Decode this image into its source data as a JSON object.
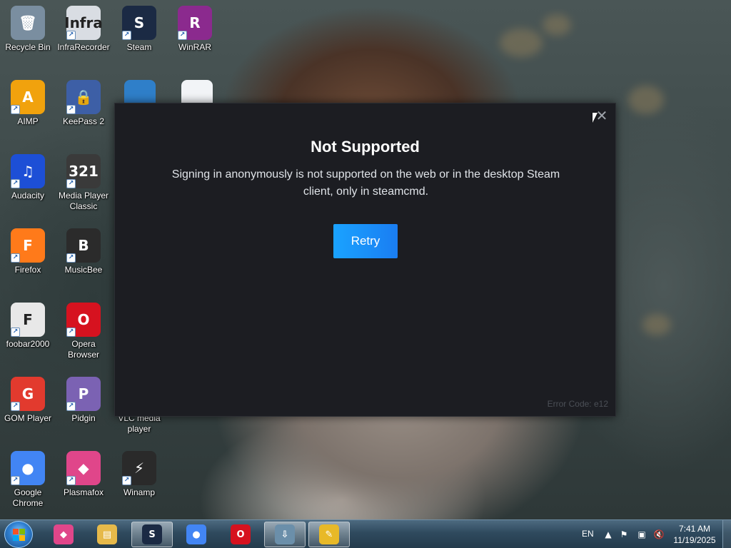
{
  "desktop": {
    "icons": [
      {
        "label": "Recycle Bin",
        "icon": "recycle-bin-icon",
        "glyph": "🗑",
        "color": "#7a8ea0"
      },
      {
        "label": "InfraRecorder",
        "icon": "infrarecorder-icon",
        "glyph": "Infra",
        "color": "#d9dde3"
      },
      {
        "label": "Steam",
        "icon": "steam-icon",
        "glyph": "S",
        "color": "#1b2a44"
      },
      {
        "label": "WinRAR",
        "icon": "winrar-icon",
        "glyph": "R",
        "color": "#8b2a8e"
      },
      {
        "label": "AIMP",
        "icon": "aimp-icon",
        "glyph": "A",
        "color": "#f1a20d"
      },
      {
        "label": "KeePass 2",
        "icon": "keepass-icon",
        "glyph": "🔒",
        "color": "#3d5fa6"
      },
      {
        "label": "Audacity",
        "icon": "audacity-icon",
        "glyph": "♫",
        "color": "#1d4fd6"
      },
      {
        "label": "Media Player Classic",
        "icon": "media-player-classic-icon",
        "glyph": "321",
        "color": "#3a3a3a"
      },
      {
        "label": "Firefox",
        "icon": "firefox-icon",
        "glyph": "F",
        "color": "#ff7a1a"
      },
      {
        "label": "MusicBee",
        "icon": "musicbee-icon",
        "glyph": "B",
        "color": "#2b2b2b"
      },
      {
        "label": "foobar2000",
        "icon": "foobar2000-icon",
        "glyph": "F",
        "color": "#e8e8e8"
      },
      {
        "label": "Opera Browser",
        "icon": "opera-icon",
        "glyph": "O",
        "color": "#d6121f"
      },
      {
        "label": "GOM Player",
        "icon": "gom-player-icon",
        "glyph": "G",
        "color": "#e23a2e"
      },
      {
        "label": "Pidgin",
        "icon": "pidgin-icon",
        "glyph": "P",
        "color": "#7b62b3"
      },
      {
        "label": "VLC media player",
        "icon": "vlc-icon",
        "glyph": "▲",
        "color": "#f08a00"
      },
      {
        "label": "Google Chrome",
        "icon": "chrome-icon",
        "glyph": "●",
        "color": "#4285f4"
      },
      {
        "label": "Plasmafox",
        "icon": "plasmafox-icon",
        "glyph": "◆",
        "color": "#e0468a"
      },
      {
        "label": "Winamp",
        "icon": "winamp-icon",
        "glyph": "⚡",
        "color": "#2a2a2a"
      }
    ],
    "partial_icons": [
      {
        "icon": "browser-icon",
        "color": "#2f7fc9"
      },
      {
        "icon": "document-icon",
        "color": "#f2f4f7"
      }
    ]
  },
  "dialog": {
    "title": "Not Supported",
    "message": "Signing in anonymously is not supported on the web or in the desktop Steam client, only in steamcmd.",
    "retry_label": "Retry",
    "error_code": "Error Code: e12",
    "close_glyph": "✕"
  },
  "taskbar": {
    "items": [
      {
        "icon": "plasmafox-icon",
        "glyph": "◆",
        "color": "#e0468a",
        "active": false
      },
      {
        "icon": "file-explorer-icon",
        "glyph": "▤",
        "color": "#e6b94a",
        "active": false
      },
      {
        "icon": "steam-icon",
        "glyph": "S",
        "color": "#1b2a44",
        "active": true
      },
      {
        "icon": "chrome-icon",
        "glyph": "●",
        "color": "#4285f4",
        "active": false
      },
      {
        "icon": "opera-icon",
        "glyph": "O",
        "color": "#d6121f",
        "active": false
      },
      {
        "icon": "desktop-switch-icon",
        "glyph": "⇩",
        "color": "#6b8faa",
        "active": true
      },
      {
        "icon": "notes-icon",
        "glyph": "✎",
        "color": "#e8b928",
        "active": true
      }
    ],
    "language": "EN",
    "time": "7:41 AM",
    "date": "11/19/2025"
  }
}
